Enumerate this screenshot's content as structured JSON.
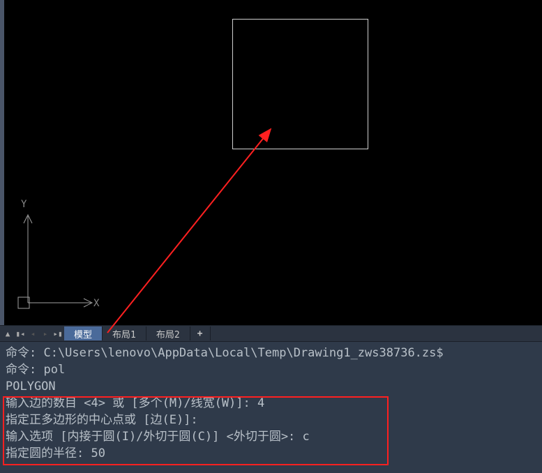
{
  "viewport": {
    "axis_y_label": "Y",
    "axis_x_label": "X"
  },
  "tabs": {
    "model": "模型",
    "layout1": "布局1",
    "layout2": "布局2",
    "add": "+"
  },
  "command": {
    "line1": "命令: C:\\Users\\lenovo\\AppData\\Local\\Temp\\Drawing1_zws38736.zs$",
    "line2": "命令: pol",
    "line3": "POLYGON",
    "line4": "输入边的数目 <4> 或 [多个(M)/线宽(W)]: 4",
    "line5": "指定正多边形的中心点或 [边(E)]:",
    "line6": "输入选项 [内接于圆(I)/外切于圆(C)] <外切于圆>: c",
    "line7": "指定圆的半径: 50"
  }
}
